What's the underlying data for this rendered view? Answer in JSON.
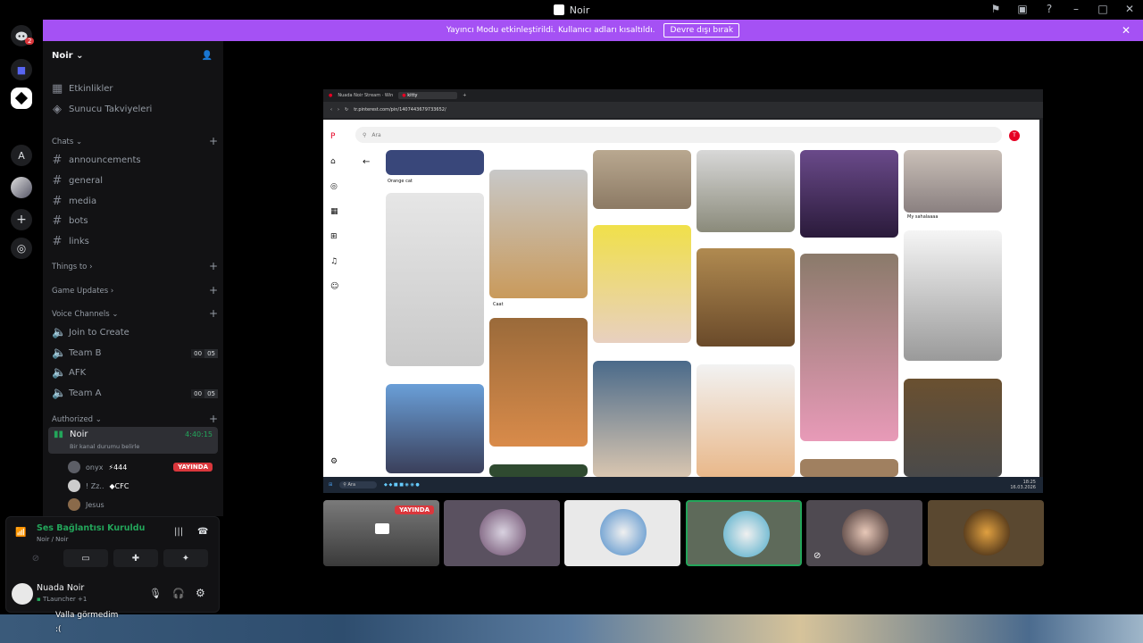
{
  "window": {
    "title": "Noir"
  },
  "server_rail": {
    "badge": "2",
    "letter_server": "A"
  },
  "notice": {
    "text": "Yayıncı Modu etkinleştirildi. Kullanıcı adları kısaltıldı.",
    "button": "Devre dışı bırak"
  },
  "sidebar": {
    "server_name": "Noir",
    "top_items": [
      "Etkinlikler",
      "Sunucu Takviyeleri"
    ],
    "chats_label": "Chats",
    "channels": [
      "announcements",
      "general",
      "media",
      "bots",
      "links"
    ],
    "things_label": "Things to",
    "game_updates_label": "Game Updates",
    "voice_label": "Voice Channels",
    "voice_channels": [
      {
        "name": "Join to Create",
        "a": "",
        "b": ""
      },
      {
        "name": "Team B",
        "a": "00",
        "b": "05"
      },
      {
        "name": "AFK",
        "a": "",
        "b": ""
      },
      {
        "name": "Team A",
        "a": "00",
        "b": "05"
      }
    ],
    "authorized_label": "Authorized",
    "active_vc": {
      "name": "Noir",
      "time": "4:40:15",
      "status": "Bir kanal durumu belirle"
    },
    "vc_users": [
      {
        "name": "onyx",
        "extra": "444",
        "live": "YAYINDA"
      },
      {
        "name": "! Zz..",
        "extra": "CFC",
        "live": ""
      },
      {
        "name": "Jesus",
        "extra": "",
        "live": ""
      }
    ]
  },
  "voice_panel": {
    "status": "Ses Bağlantısı Kuruldu",
    "channel": "Noir / Noir",
    "user_name": "Nuada Noir",
    "user_activity": "TLauncher +1"
  },
  "stream": {
    "browser_tab": "Nuada Noir Stream · Win",
    "browser_tab2": "kitty",
    "url": "tr.pinterest.com/pin/1407443679733652/",
    "search_placeholder": "Ara",
    "avatar_letter": "T",
    "captions": [
      "Orange cat",
      "Caat",
      "My sahalaaaa"
    ],
    "taskbar_search": "Ara",
    "clock": "18:25",
    "date": "16.03.2026"
  },
  "tiles": {
    "live_badge": "YAYINDA"
  },
  "chat_overlay": {
    "line1": "Valla görmedim",
    "line2": ":("
  },
  "colors": {
    "accent": "#a551f4",
    "live": "#da373c",
    "connected": "#23a55a",
    "pinterest": "#e60023"
  }
}
